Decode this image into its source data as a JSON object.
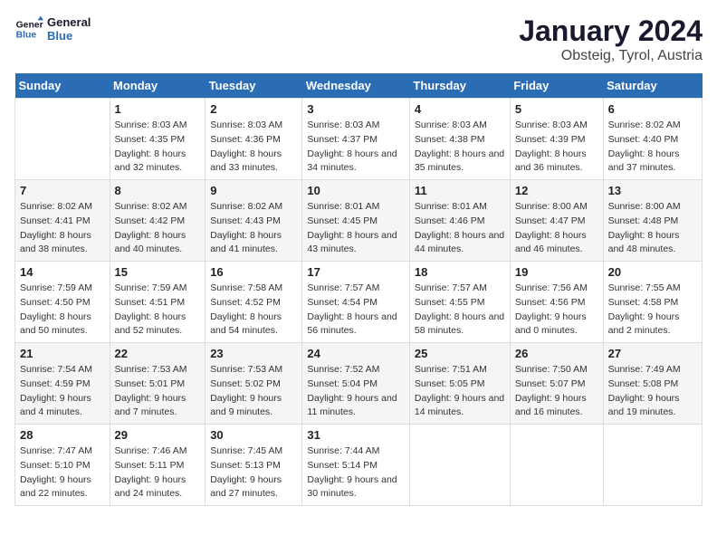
{
  "header": {
    "logo_line1": "General",
    "logo_line2": "Blue",
    "title": "January 2024",
    "subtitle": "Obsteig, Tyrol, Austria"
  },
  "weekdays": [
    "Sunday",
    "Monday",
    "Tuesday",
    "Wednesday",
    "Thursday",
    "Friday",
    "Saturday"
  ],
  "weeks": [
    [
      {
        "day": "",
        "sunrise": "",
        "sunset": "",
        "daylight": ""
      },
      {
        "day": "1",
        "sunrise": "Sunrise: 8:03 AM",
        "sunset": "Sunset: 4:35 PM",
        "daylight": "Daylight: 8 hours and 32 minutes."
      },
      {
        "day": "2",
        "sunrise": "Sunrise: 8:03 AM",
        "sunset": "Sunset: 4:36 PM",
        "daylight": "Daylight: 8 hours and 33 minutes."
      },
      {
        "day": "3",
        "sunrise": "Sunrise: 8:03 AM",
        "sunset": "Sunset: 4:37 PM",
        "daylight": "Daylight: 8 hours and 34 minutes."
      },
      {
        "day": "4",
        "sunrise": "Sunrise: 8:03 AM",
        "sunset": "Sunset: 4:38 PM",
        "daylight": "Daylight: 8 hours and 35 minutes."
      },
      {
        "day": "5",
        "sunrise": "Sunrise: 8:03 AM",
        "sunset": "Sunset: 4:39 PM",
        "daylight": "Daylight: 8 hours and 36 minutes."
      },
      {
        "day": "6",
        "sunrise": "Sunrise: 8:02 AM",
        "sunset": "Sunset: 4:40 PM",
        "daylight": "Daylight: 8 hours and 37 minutes."
      }
    ],
    [
      {
        "day": "7",
        "sunrise": "Sunrise: 8:02 AM",
        "sunset": "Sunset: 4:41 PM",
        "daylight": "Daylight: 8 hours and 38 minutes."
      },
      {
        "day": "8",
        "sunrise": "Sunrise: 8:02 AM",
        "sunset": "Sunset: 4:42 PM",
        "daylight": "Daylight: 8 hours and 40 minutes."
      },
      {
        "day": "9",
        "sunrise": "Sunrise: 8:02 AM",
        "sunset": "Sunset: 4:43 PM",
        "daylight": "Daylight: 8 hours and 41 minutes."
      },
      {
        "day": "10",
        "sunrise": "Sunrise: 8:01 AM",
        "sunset": "Sunset: 4:45 PM",
        "daylight": "Daylight: 8 hours and 43 minutes."
      },
      {
        "day": "11",
        "sunrise": "Sunrise: 8:01 AM",
        "sunset": "Sunset: 4:46 PM",
        "daylight": "Daylight: 8 hours and 44 minutes."
      },
      {
        "day": "12",
        "sunrise": "Sunrise: 8:00 AM",
        "sunset": "Sunset: 4:47 PM",
        "daylight": "Daylight: 8 hours and 46 minutes."
      },
      {
        "day": "13",
        "sunrise": "Sunrise: 8:00 AM",
        "sunset": "Sunset: 4:48 PM",
        "daylight": "Daylight: 8 hours and 48 minutes."
      }
    ],
    [
      {
        "day": "14",
        "sunrise": "Sunrise: 7:59 AM",
        "sunset": "Sunset: 4:50 PM",
        "daylight": "Daylight: 8 hours and 50 minutes."
      },
      {
        "day": "15",
        "sunrise": "Sunrise: 7:59 AM",
        "sunset": "Sunset: 4:51 PM",
        "daylight": "Daylight: 8 hours and 52 minutes."
      },
      {
        "day": "16",
        "sunrise": "Sunrise: 7:58 AM",
        "sunset": "Sunset: 4:52 PM",
        "daylight": "Daylight: 8 hours and 54 minutes."
      },
      {
        "day": "17",
        "sunrise": "Sunrise: 7:57 AM",
        "sunset": "Sunset: 4:54 PM",
        "daylight": "Daylight: 8 hours and 56 minutes."
      },
      {
        "day": "18",
        "sunrise": "Sunrise: 7:57 AM",
        "sunset": "Sunset: 4:55 PM",
        "daylight": "Daylight: 8 hours and 58 minutes."
      },
      {
        "day": "19",
        "sunrise": "Sunrise: 7:56 AM",
        "sunset": "Sunset: 4:56 PM",
        "daylight": "Daylight: 9 hours and 0 minutes."
      },
      {
        "day": "20",
        "sunrise": "Sunrise: 7:55 AM",
        "sunset": "Sunset: 4:58 PM",
        "daylight": "Daylight: 9 hours and 2 minutes."
      }
    ],
    [
      {
        "day": "21",
        "sunrise": "Sunrise: 7:54 AM",
        "sunset": "Sunset: 4:59 PM",
        "daylight": "Daylight: 9 hours and 4 minutes."
      },
      {
        "day": "22",
        "sunrise": "Sunrise: 7:53 AM",
        "sunset": "Sunset: 5:01 PM",
        "daylight": "Daylight: 9 hours and 7 minutes."
      },
      {
        "day": "23",
        "sunrise": "Sunrise: 7:53 AM",
        "sunset": "Sunset: 5:02 PM",
        "daylight": "Daylight: 9 hours and 9 minutes."
      },
      {
        "day": "24",
        "sunrise": "Sunrise: 7:52 AM",
        "sunset": "Sunset: 5:04 PM",
        "daylight": "Daylight: 9 hours and 11 minutes."
      },
      {
        "day": "25",
        "sunrise": "Sunrise: 7:51 AM",
        "sunset": "Sunset: 5:05 PM",
        "daylight": "Daylight: 9 hours and 14 minutes."
      },
      {
        "day": "26",
        "sunrise": "Sunrise: 7:50 AM",
        "sunset": "Sunset: 5:07 PM",
        "daylight": "Daylight: 9 hours and 16 minutes."
      },
      {
        "day": "27",
        "sunrise": "Sunrise: 7:49 AM",
        "sunset": "Sunset: 5:08 PM",
        "daylight": "Daylight: 9 hours and 19 minutes."
      }
    ],
    [
      {
        "day": "28",
        "sunrise": "Sunrise: 7:47 AM",
        "sunset": "Sunset: 5:10 PM",
        "daylight": "Daylight: 9 hours and 22 minutes."
      },
      {
        "day": "29",
        "sunrise": "Sunrise: 7:46 AM",
        "sunset": "Sunset: 5:11 PM",
        "daylight": "Daylight: 9 hours and 24 minutes."
      },
      {
        "day": "30",
        "sunrise": "Sunrise: 7:45 AM",
        "sunset": "Sunset: 5:13 PM",
        "daylight": "Daylight: 9 hours and 27 minutes."
      },
      {
        "day": "31",
        "sunrise": "Sunrise: 7:44 AM",
        "sunset": "Sunset: 5:14 PM",
        "daylight": "Daylight: 9 hours and 30 minutes."
      },
      {
        "day": "",
        "sunrise": "",
        "sunset": "",
        "daylight": ""
      },
      {
        "day": "",
        "sunrise": "",
        "sunset": "",
        "daylight": ""
      },
      {
        "day": "",
        "sunrise": "",
        "sunset": "",
        "daylight": ""
      }
    ]
  ]
}
